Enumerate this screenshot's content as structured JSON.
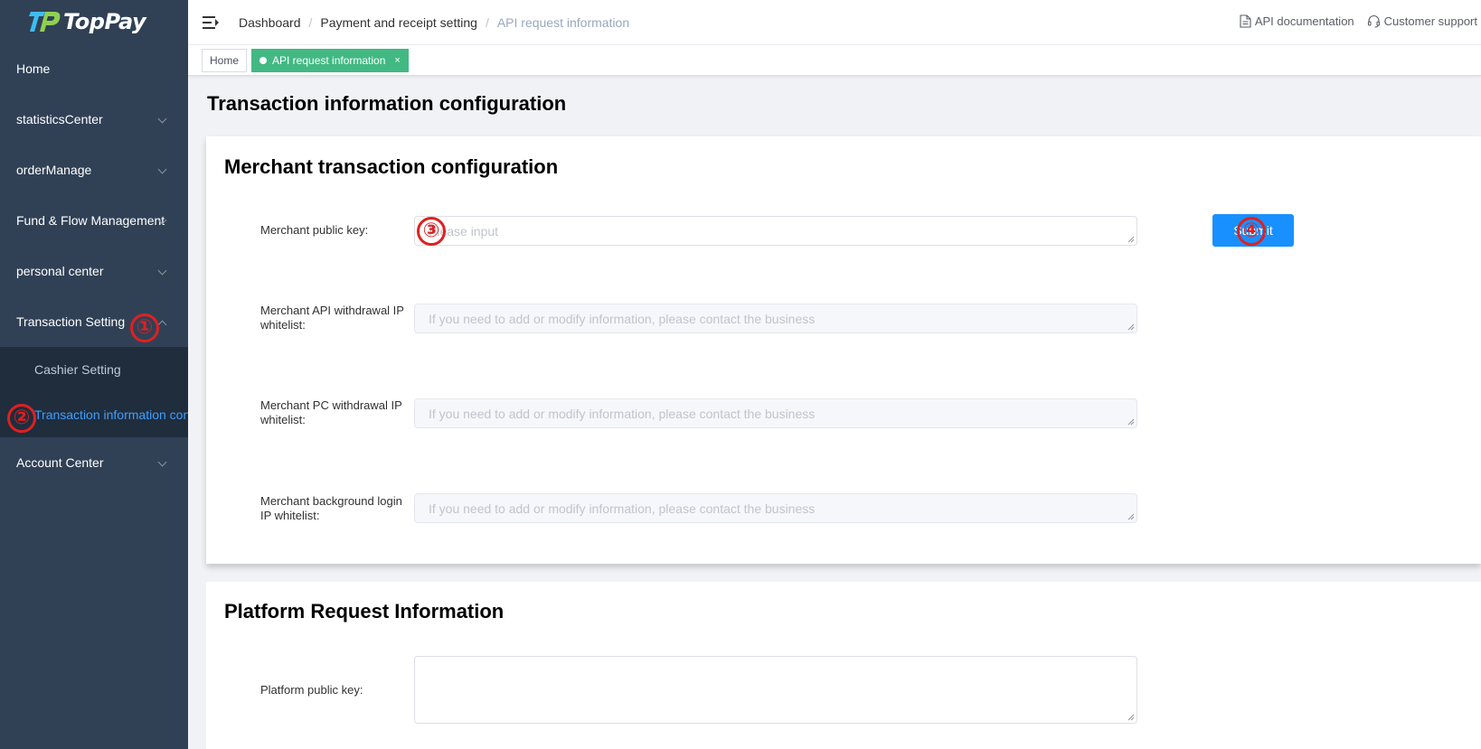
{
  "brand": {
    "name": "TopPay"
  },
  "sidebar": {
    "items": [
      {
        "label": "Home"
      },
      {
        "label": "statisticsCenter"
      },
      {
        "label": "orderManage"
      },
      {
        "label": "Fund & Flow Management"
      },
      {
        "label": "personal center"
      },
      {
        "label": "Transaction Setting"
      },
      {
        "label": "Account Center"
      }
    ],
    "submenu": [
      {
        "label": "Cashier Setting"
      },
      {
        "label": "Transaction information configuration"
      }
    ]
  },
  "header": {
    "breadcrumb": [
      "Dashboard",
      "Payment and receipt setting",
      "API request information"
    ],
    "separator": "/",
    "links": {
      "api_docs": "API documentation",
      "support": "Customer support"
    }
  },
  "tags": {
    "home": "Home",
    "active": "API request information",
    "close": "×"
  },
  "page": {
    "title": "Transaction information configuration",
    "merchant_section": {
      "title": "Merchant transaction configuration",
      "public_key_label": "Merchant public key:",
      "public_key_placeholder": "Please input",
      "submit": "Submit",
      "api_whitelist_label": "Merchant API withdrawal IP whitelist:",
      "pc_whitelist_label": "Merchant PC withdrawal IP whitelist:",
      "login_whitelist_label": "Merchant background login IP whitelist:",
      "whitelist_placeholder": "If you need to add or modify information, please contact the business"
    },
    "platform_section": {
      "title": "Platform Request Information",
      "public_key_label": "Platform public key:"
    }
  },
  "annotations": [
    "①",
    "②",
    "③",
    "④"
  ],
  "colors": {
    "sidebar_bg": "#304156",
    "active_link": "#409eff",
    "tag_active": "#42b983",
    "submit": "#1890ff",
    "annotation": "#e02020"
  }
}
